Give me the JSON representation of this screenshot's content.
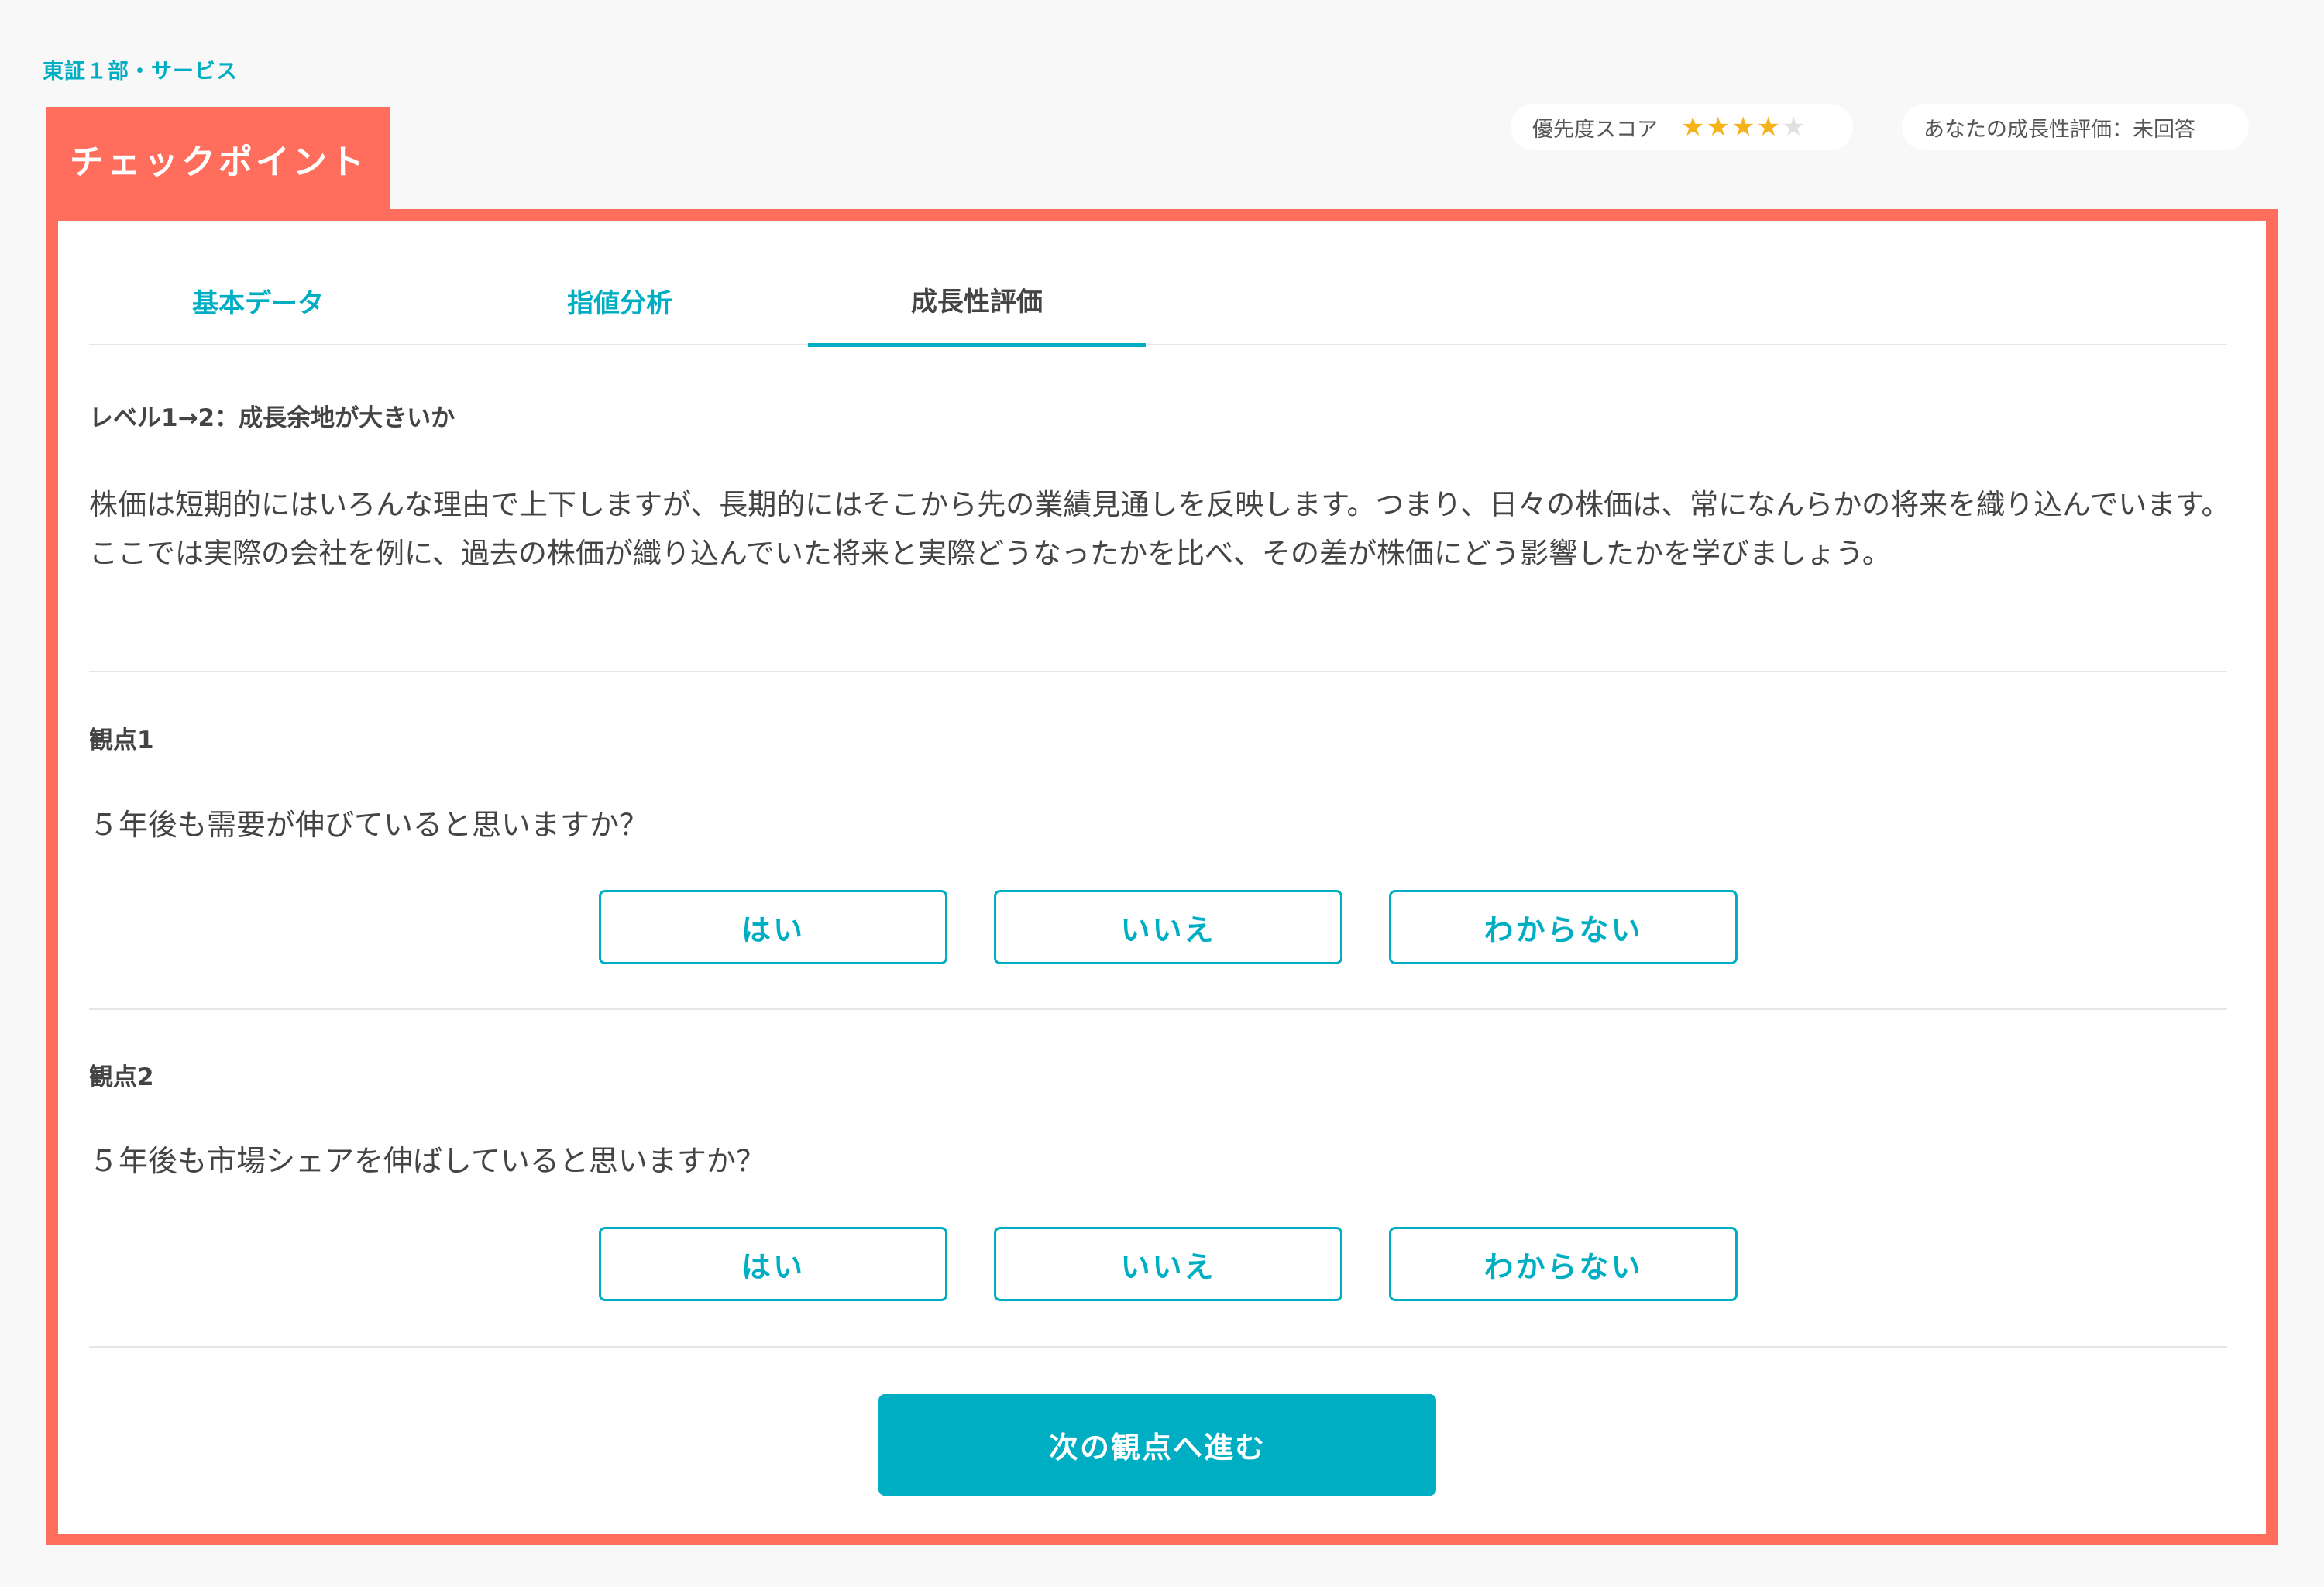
{
  "market_label": "東証１部・サービス",
  "checkpoint_title": "チェックポイント",
  "priority": {
    "label": "優先度スコア",
    "stars_filled": 4,
    "stars_total": 5
  },
  "growth_status": "あなたの成長性評価：未回答",
  "tabs": [
    {
      "label": "基本データ",
      "active": false
    },
    {
      "label": "指値分析",
      "active": false
    },
    {
      "label": "成長性評価",
      "active": true
    }
  ],
  "level_title": "レベル1→2：成長余地が大きいか",
  "intro_line1": "株価は短期的にはいろんな理由で上下しますが、長期的にはそこから先の業績見通しを反映します。つまり、日々の株価は、常になんらかの将来を織り込んでいます。",
  "intro_line2": "ここでは実際の会社を例に、過去の株価が織り込んでいた将来と実際どうなったかを比べ、その差が株価にどう影響したかを学びましょう。",
  "viewpoints": [
    {
      "label": "観点1",
      "question": "５年後も需要が伸びていると思いますか？",
      "answers": [
        "はい",
        "いいえ",
        "わからない"
      ]
    },
    {
      "label": "観点2",
      "question": "５年後も市場シェアを伸ばしていると思いますか？",
      "answers": [
        "はい",
        "いいえ",
        "わからない"
      ]
    }
  ],
  "next_button": "次の観点へ進む",
  "colors": {
    "accent": "#00aec4",
    "checkpoint": "#ff6e5c",
    "star_on": "#f5b21a",
    "star_off": "#e0e0e0"
  }
}
